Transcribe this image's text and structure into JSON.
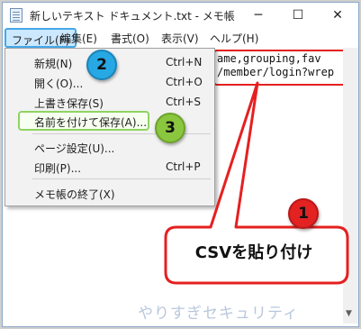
{
  "window": {
    "title": "新しいテキスト ドキュメント.txt - メモ帳",
    "minimize_glyph": "─",
    "maximize_glyph": "☐",
    "close_glyph": "✕"
  },
  "menubar": {
    "file": "ファイル(F)",
    "edit": "編集(E)",
    "format": "書式(O)",
    "view": "表示(V)",
    "help": "ヘルプ(H)"
  },
  "editor": {
    "line1": "ame,grouping,fav",
    "line2": "/member/login?wrep"
  },
  "file_menu": {
    "new": {
      "label": "新規(N)",
      "shortcut": "Ctrl+N"
    },
    "open": {
      "label": "開く(O)...",
      "shortcut": "Ctrl+O"
    },
    "save": {
      "label": "上書き保存(S)",
      "shortcut": "Ctrl+S"
    },
    "save_as": {
      "label": "名前を付けて保存(A)..."
    },
    "page_setup": {
      "label": "ページ設定(U)..."
    },
    "print": {
      "label": "印刷(P)...",
      "shortcut": "Ctrl+P"
    },
    "exit": {
      "label": "メモ帳の終了(X)"
    }
  },
  "annotations": {
    "step1": "1",
    "step2": "2",
    "step3": "3",
    "bubble_text": "CSVを貼り付け",
    "watermark": "やりすぎセキュリティ"
  },
  "colors": {
    "step1": "#e32222",
    "step2": "#27a8e4",
    "step3": "#8bc63f",
    "highlight": "#e52020"
  }
}
